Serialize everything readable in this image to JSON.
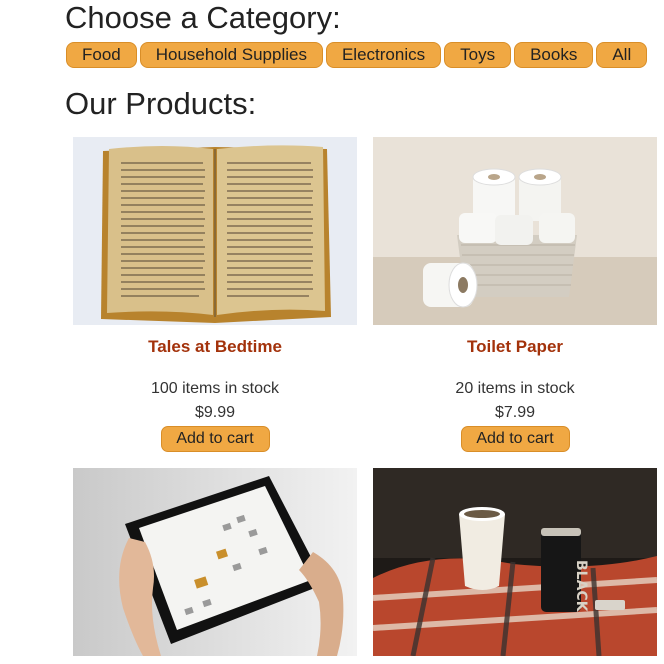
{
  "category_heading": "Choose a Category:",
  "categories": [
    "Food",
    "Household Supplies",
    "Electronics",
    "Toys",
    "Books",
    "All"
  ],
  "products_heading": "Our Products:",
  "products": [
    {
      "name": "Tales at Bedtime",
      "stock": "100 items in stock",
      "price": "$9.99",
      "button": "Add to cart",
      "image": "open-book-photo"
    },
    {
      "name": "Toilet Paper",
      "stock": "20 items in stock",
      "price": "$7.99",
      "button": "Add to cart",
      "image": "toilet-paper-basket-photo"
    },
    {
      "image": "tablet-photo"
    },
    {
      "image": "coffee-cup-and-can-photo"
    }
  ],
  "colors": {
    "button_bg": "#f0a843",
    "product_name": "#a3320b"
  }
}
